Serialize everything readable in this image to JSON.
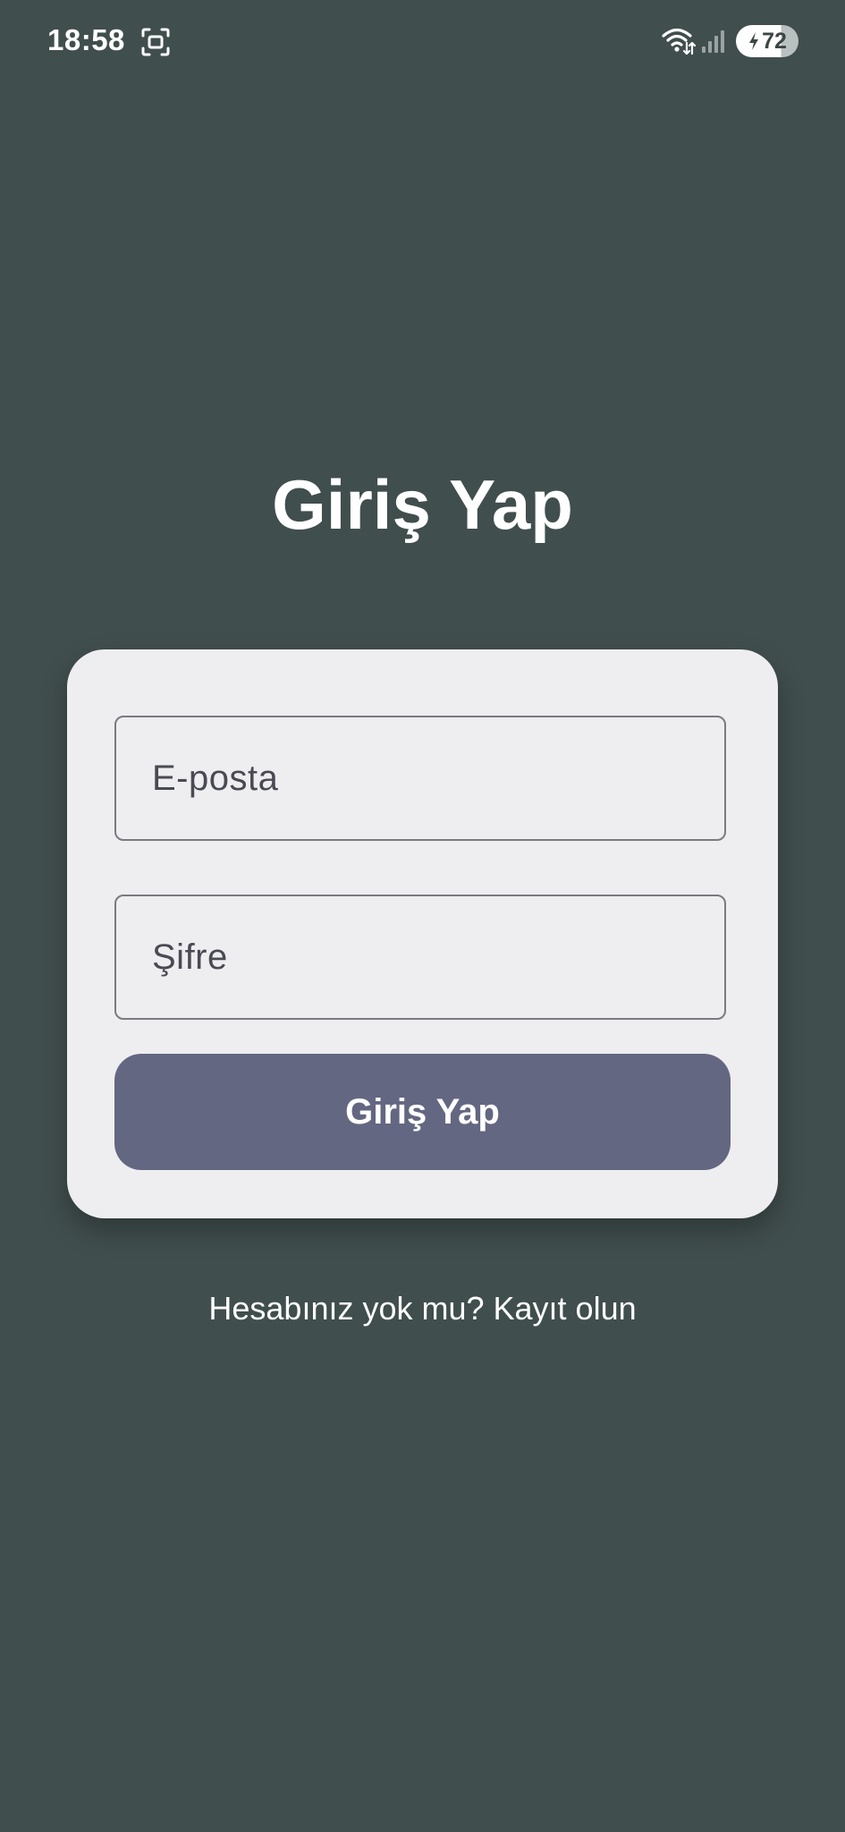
{
  "status_bar": {
    "time": "18:58",
    "battery_level": "72",
    "icons": [
      "screenshot-icon",
      "wifi-icon",
      "signal-icon",
      "battery-charging-icon"
    ]
  },
  "page": {
    "title": "Giriş Yap"
  },
  "form": {
    "email_placeholder": "E-posta",
    "password_placeholder": "Şifre",
    "submit_label": "Giriş Yap"
  },
  "footer": {
    "register_link": "Hesabınız yok mu? Kayıt olun"
  },
  "colors": {
    "background": "#404e4d",
    "card": "#eeeef1",
    "button": "#646781",
    "field_border": "#7a7a80"
  }
}
